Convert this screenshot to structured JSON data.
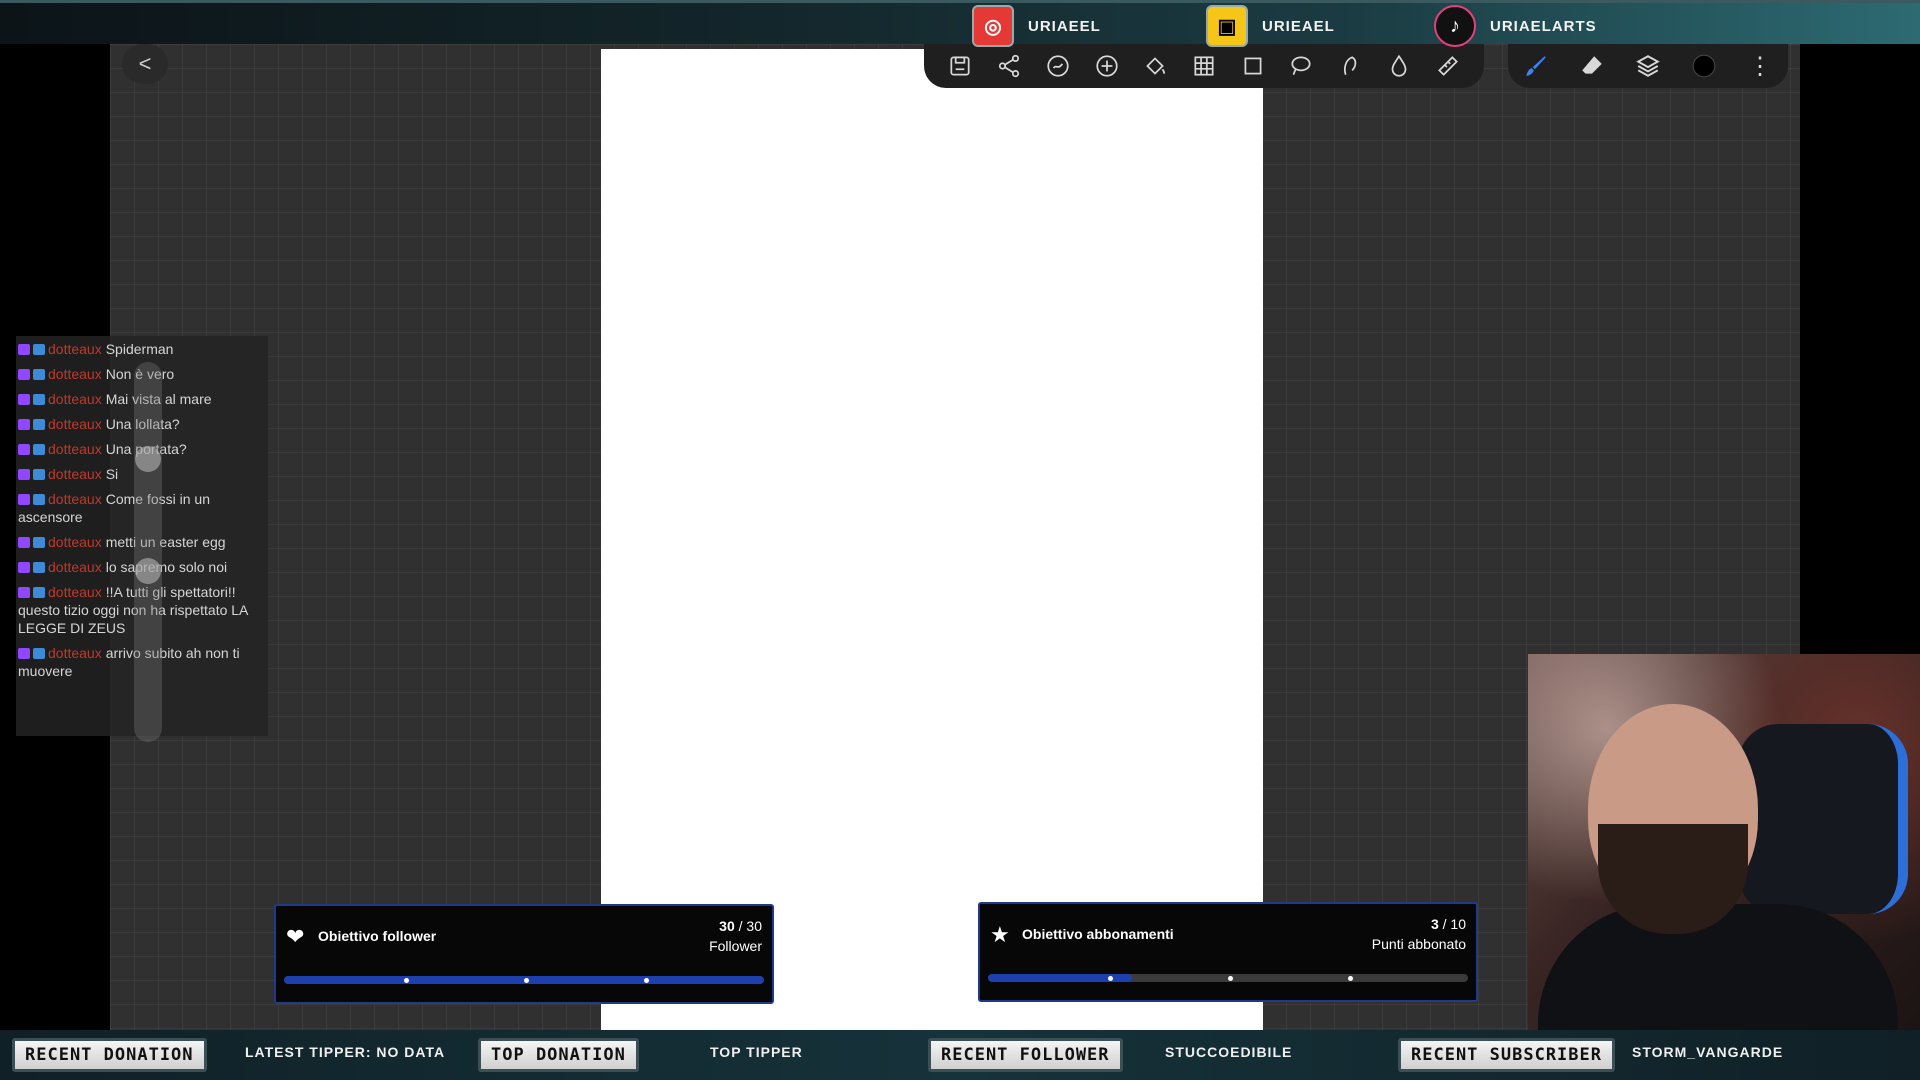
{
  "social": {
    "instagram": "URIAEEL",
    "twitch": "URIEAEL",
    "tiktok": "URIAELARTS"
  },
  "toolbar": {
    "back": "<",
    "tools": [
      "save-icon",
      "share-icon",
      "gesture-icon",
      "plus-icon",
      "fill-icon",
      "grid-icon",
      "crop-icon",
      "lasso-icon",
      "smudge-icon",
      "drop-icon",
      "ruler-icon"
    ],
    "right_tools": [
      "brush-icon",
      "eraser-icon",
      "layers-icon",
      "color-swatch",
      "more-icon"
    ],
    "more_label": "⋮"
  },
  "chat": {
    "user": "dotteaux",
    "messages": [
      "Spiderman",
      "Non è vero",
      "Mai vista al mare",
      "Una lollata?",
      "Una portata?",
      "Si",
      "Come fossi in un ascensore",
      "metti un easter egg",
      "lo sapremo solo noi",
      "!!A tutti gli spettatori!! questo tizio oggi non ha rispettato LA LEGGE DI ZEUS",
      "arrivo subito ah non ti muovere"
    ]
  },
  "goals": {
    "follower": {
      "title": "Obiettivo follower",
      "current": "30",
      "separator": "/",
      "target": "30",
      "unit": "Follower",
      "progress": 1.0
    },
    "subs": {
      "title": "Obiettivo abbonamenti",
      "current": "3",
      "separator": "/",
      "target": "10",
      "unit": "Punti abbonato",
      "progress": 0.3
    }
  },
  "bottom": {
    "recent_donation_label": "RECENT DONATION",
    "recent_donation_value": "LATEST TIPPER: NO DATA",
    "top_donation_label": "TOP DONATION",
    "top_donation_value": "TOP TIPPER",
    "recent_follower_label": "RECENT FOLLOWER",
    "recent_follower_value": "STUCCOEDIBILE",
    "recent_subscriber_label": "RECENT SUBSCRIBER",
    "recent_subscriber_value": "STORM_VANGARDE"
  },
  "colors": {
    "accent_blue": "#1e40af",
    "chat_user": "#c0392b",
    "instagram": "#e53935",
    "twitch": "#f5c518"
  }
}
